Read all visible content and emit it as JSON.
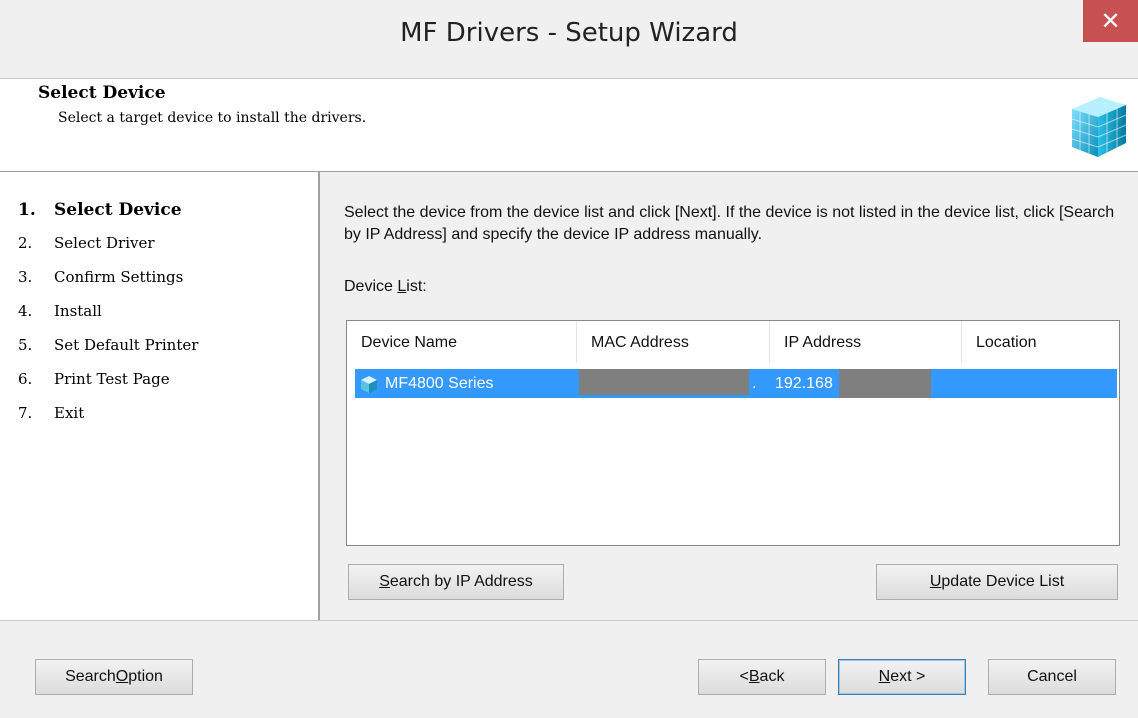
{
  "window": {
    "title": "MF Drivers - Setup Wizard",
    "close_glyph": "✕"
  },
  "header": {
    "title": "Select Device",
    "subtitle": "Select a target device to install the drivers."
  },
  "steps": [
    {
      "num": "1.",
      "label": "Select Device",
      "active": true
    },
    {
      "num": "2.",
      "label": "Select Driver"
    },
    {
      "num": "3.",
      "label": "Confirm Settings"
    },
    {
      "num": "4.",
      "label": "Install"
    },
    {
      "num": "5.",
      "label": "Set Default Printer"
    },
    {
      "num": "6.",
      "label": "Print Test Page"
    },
    {
      "num": "7.",
      "label": "Exit"
    }
  ],
  "content": {
    "instruction": "Select the device from the device list and click [Next]. If the device is not listed in the device list, click [Search by IP Address] and specify the device IP address manually.",
    "device_list_label_pre": "Device ",
    "device_list_label_ul": "L",
    "device_list_label_post": "ist:",
    "columns": [
      "Device Name",
      "MAC Address",
      "IP Address",
      "Location"
    ],
    "rows": [
      {
        "device_name": "MF4800 Series",
        "mac_suffix": ".",
        "ip_address": "192.168",
        "location": "",
        "selected": true
      }
    ]
  },
  "buttons": {
    "search_ip": {
      "ul": "S",
      "rest": "earch by IP Address"
    },
    "update_list": {
      "ul": "U",
      "rest": "pdate Device List"
    },
    "search_option": {
      "pre": "Search ",
      "ul": "O",
      "rest": "ption"
    },
    "back": {
      "pre": "< ",
      "ul": "B",
      "rest": "ack"
    },
    "next": {
      "ul": "N",
      "rest": "ext >"
    },
    "cancel": "Cancel"
  },
  "colors": {
    "selection": "#3399ff",
    "close": "#c75050"
  }
}
